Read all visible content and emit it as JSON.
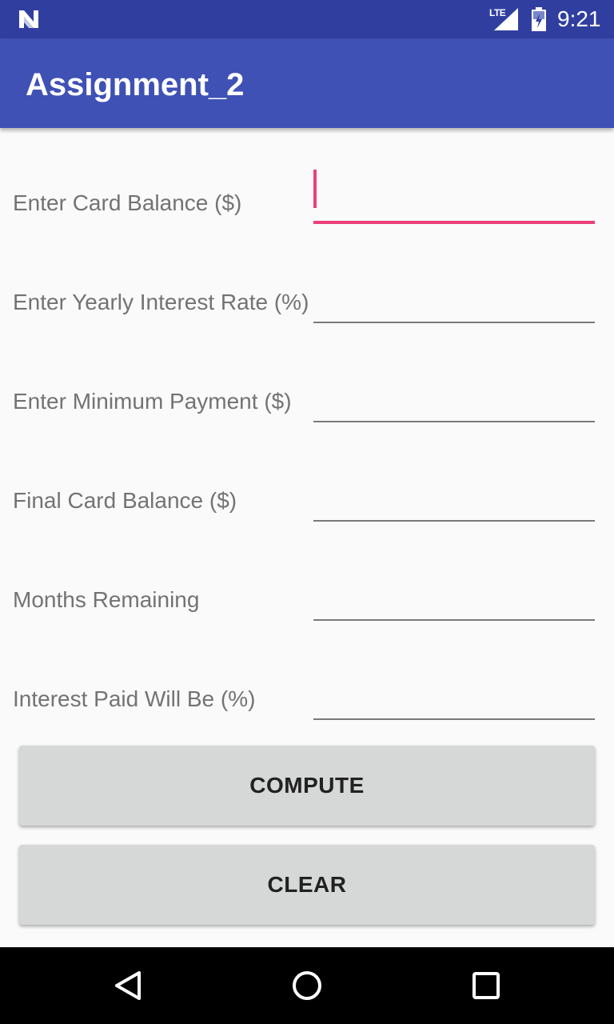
{
  "status_bar": {
    "time": "9:21",
    "network_label": "LTE",
    "icons": [
      "n-logo-icon",
      "signal-icon",
      "battery-icon"
    ]
  },
  "app_bar": {
    "title": "Assignment_2"
  },
  "form": {
    "rows": [
      {
        "label": "Enter Card Balance ($)",
        "value": "",
        "focused": true
      },
      {
        "label": "Enter Yearly Interest Rate (%)",
        "value": ""
      },
      {
        "label": "Enter Minimum Payment ($)",
        "value": ""
      },
      {
        "label": "Final Card Balance ($)",
        "value": ""
      },
      {
        "label": "Months Remaining",
        "value": ""
      },
      {
        "label": "Interest Paid Will Be (%)",
        "value": ""
      }
    ]
  },
  "buttons": {
    "compute_label": "COMPUTE",
    "clear_label": "CLEAR"
  },
  "nav_bar": {
    "icons": [
      "back-icon",
      "home-icon",
      "recents-icon"
    ]
  },
  "colors": {
    "status_bar": "#303f9f",
    "app_bar": "#3f51b5",
    "accent": "#ec407a",
    "button": "#d6d7d7",
    "background": "#fafafa"
  }
}
